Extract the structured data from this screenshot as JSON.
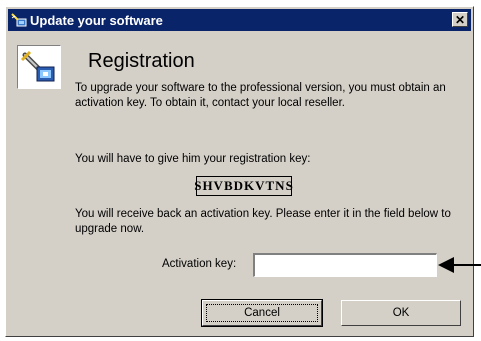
{
  "window": {
    "title": "Update your software",
    "close_glyph": "✕"
  },
  "content": {
    "heading": "Registration",
    "paragraph1": "To upgrade your software to the professional version, you must obtain an activation key. To obtain it, contact your local reseller.",
    "paragraph2": "You will have to give him your registration key:",
    "registration_key": "SHVBDKVTNS",
    "paragraph3": "You will receive back an activation key. Please enter it in the field below to upgrade now.",
    "activation_label": "Activation key:",
    "activation_value": ""
  },
  "buttons": {
    "cancel": "Cancel",
    "ok": "OK"
  },
  "icons": {
    "title": "software-update-icon",
    "app": "install-box-icon",
    "callout": "arrow-left-icon"
  },
  "colors": {
    "titlebar": "#0a246a",
    "dialog_bg": "#d4d0c8"
  }
}
